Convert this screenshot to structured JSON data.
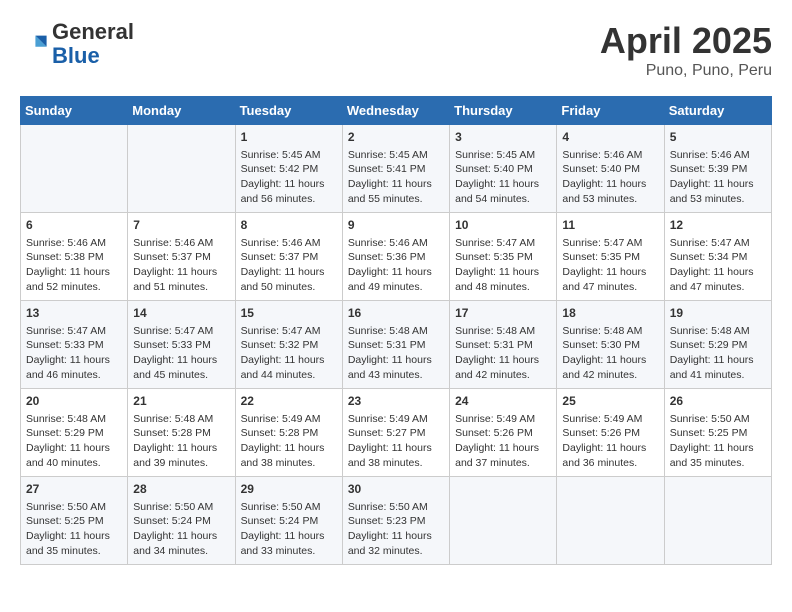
{
  "header": {
    "logo": {
      "general": "General",
      "blue": "Blue"
    },
    "title": "April 2025",
    "subtitle": "Puno, Puno, Peru"
  },
  "days_of_week": [
    "Sunday",
    "Monday",
    "Tuesday",
    "Wednesday",
    "Thursday",
    "Friday",
    "Saturday"
  ],
  "weeks": [
    [
      {
        "day": "",
        "content": ""
      },
      {
        "day": "",
        "content": ""
      },
      {
        "day": "1",
        "content": "Sunrise: 5:45 AM\nSunset: 5:42 PM\nDaylight: 11 hours and 56 minutes."
      },
      {
        "day": "2",
        "content": "Sunrise: 5:45 AM\nSunset: 5:41 PM\nDaylight: 11 hours and 55 minutes."
      },
      {
        "day": "3",
        "content": "Sunrise: 5:45 AM\nSunset: 5:40 PM\nDaylight: 11 hours and 54 minutes."
      },
      {
        "day": "4",
        "content": "Sunrise: 5:46 AM\nSunset: 5:40 PM\nDaylight: 11 hours and 53 minutes."
      },
      {
        "day": "5",
        "content": "Sunrise: 5:46 AM\nSunset: 5:39 PM\nDaylight: 11 hours and 53 minutes."
      }
    ],
    [
      {
        "day": "6",
        "content": "Sunrise: 5:46 AM\nSunset: 5:38 PM\nDaylight: 11 hours and 52 minutes."
      },
      {
        "day": "7",
        "content": "Sunrise: 5:46 AM\nSunset: 5:37 PM\nDaylight: 11 hours and 51 minutes."
      },
      {
        "day": "8",
        "content": "Sunrise: 5:46 AM\nSunset: 5:37 PM\nDaylight: 11 hours and 50 minutes."
      },
      {
        "day": "9",
        "content": "Sunrise: 5:46 AM\nSunset: 5:36 PM\nDaylight: 11 hours and 49 minutes."
      },
      {
        "day": "10",
        "content": "Sunrise: 5:47 AM\nSunset: 5:35 PM\nDaylight: 11 hours and 48 minutes."
      },
      {
        "day": "11",
        "content": "Sunrise: 5:47 AM\nSunset: 5:35 PM\nDaylight: 11 hours and 47 minutes."
      },
      {
        "day": "12",
        "content": "Sunrise: 5:47 AM\nSunset: 5:34 PM\nDaylight: 11 hours and 47 minutes."
      }
    ],
    [
      {
        "day": "13",
        "content": "Sunrise: 5:47 AM\nSunset: 5:33 PM\nDaylight: 11 hours and 46 minutes."
      },
      {
        "day": "14",
        "content": "Sunrise: 5:47 AM\nSunset: 5:33 PM\nDaylight: 11 hours and 45 minutes."
      },
      {
        "day": "15",
        "content": "Sunrise: 5:47 AM\nSunset: 5:32 PM\nDaylight: 11 hours and 44 minutes."
      },
      {
        "day": "16",
        "content": "Sunrise: 5:48 AM\nSunset: 5:31 PM\nDaylight: 11 hours and 43 minutes."
      },
      {
        "day": "17",
        "content": "Sunrise: 5:48 AM\nSunset: 5:31 PM\nDaylight: 11 hours and 42 minutes."
      },
      {
        "day": "18",
        "content": "Sunrise: 5:48 AM\nSunset: 5:30 PM\nDaylight: 11 hours and 42 minutes."
      },
      {
        "day": "19",
        "content": "Sunrise: 5:48 AM\nSunset: 5:29 PM\nDaylight: 11 hours and 41 minutes."
      }
    ],
    [
      {
        "day": "20",
        "content": "Sunrise: 5:48 AM\nSunset: 5:29 PM\nDaylight: 11 hours and 40 minutes."
      },
      {
        "day": "21",
        "content": "Sunrise: 5:48 AM\nSunset: 5:28 PM\nDaylight: 11 hours and 39 minutes."
      },
      {
        "day": "22",
        "content": "Sunrise: 5:49 AM\nSunset: 5:28 PM\nDaylight: 11 hours and 38 minutes."
      },
      {
        "day": "23",
        "content": "Sunrise: 5:49 AM\nSunset: 5:27 PM\nDaylight: 11 hours and 38 minutes."
      },
      {
        "day": "24",
        "content": "Sunrise: 5:49 AM\nSunset: 5:26 PM\nDaylight: 11 hours and 37 minutes."
      },
      {
        "day": "25",
        "content": "Sunrise: 5:49 AM\nSunset: 5:26 PM\nDaylight: 11 hours and 36 minutes."
      },
      {
        "day": "26",
        "content": "Sunrise: 5:50 AM\nSunset: 5:25 PM\nDaylight: 11 hours and 35 minutes."
      }
    ],
    [
      {
        "day": "27",
        "content": "Sunrise: 5:50 AM\nSunset: 5:25 PM\nDaylight: 11 hours and 35 minutes."
      },
      {
        "day": "28",
        "content": "Sunrise: 5:50 AM\nSunset: 5:24 PM\nDaylight: 11 hours and 34 minutes."
      },
      {
        "day": "29",
        "content": "Sunrise: 5:50 AM\nSunset: 5:24 PM\nDaylight: 11 hours and 33 minutes."
      },
      {
        "day": "30",
        "content": "Sunrise: 5:50 AM\nSunset: 5:23 PM\nDaylight: 11 hours and 32 minutes."
      },
      {
        "day": "",
        "content": ""
      },
      {
        "day": "",
        "content": ""
      },
      {
        "day": "",
        "content": ""
      }
    ]
  ]
}
